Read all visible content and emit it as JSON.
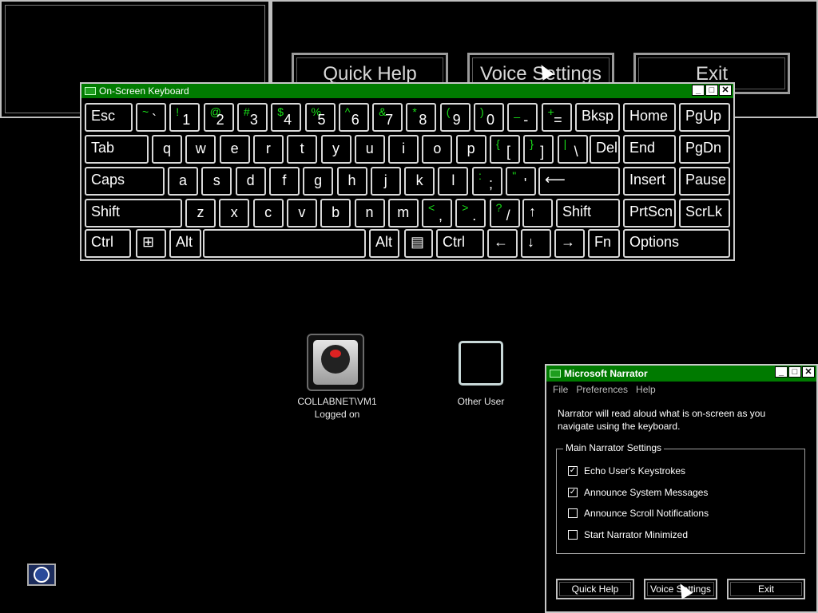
{
  "background": {
    "buttons": [
      {
        "label": "Quick Help"
      },
      {
        "label": "Voice Settings"
      },
      {
        "label": "Exit"
      }
    ]
  },
  "osk": {
    "title": "On-Screen Keyboard",
    "keys": {
      "esc": "Esc",
      "bksp": "Bksp",
      "home": "Home",
      "pgup": "PgUp",
      "tab": "Tab",
      "del": "Del",
      "end": "End",
      "pgdn": "PgDn",
      "caps": "Caps",
      "insert": "Insert",
      "pause": "Pause",
      "shift_l": "Shift",
      "shift_r": "Shift",
      "prtscn": "PrtScn",
      "scrlk": "ScrLk",
      "ctrl_l": "Ctrl",
      "alt_l": "Alt",
      "alt_r": "Alt",
      "ctrl_r": "Ctrl",
      "fn": "Fn",
      "options": "Options",
      "arrow_left": "←",
      "arrow_down": "↓",
      "arrow_right": "→",
      "arrow_up": "↑",
      "windows": "⊞",
      "menu": "▤",
      "row1": [
        {
          "u": "~",
          "l": "`"
        },
        {
          "u": "!",
          "l": "1"
        },
        {
          "u": "@",
          "l": "2"
        },
        {
          "u": "#",
          "l": "3"
        },
        {
          "u": "$",
          "l": "4"
        },
        {
          "u": "%",
          "l": "5"
        },
        {
          "u": "^",
          "l": "6"
        },
        {
          "u": "&",
          "l": "7"
        },
        {
          "u": "*",
          "l": "8"
        },
        {
          "u": "(",
          "l": "9"
        },
        {
          "u": ")",
          "l": "0"
        },
        {
          "u": "_",
          "l": "-"
        },
        {
          "u": "+",
          "l": "="
        }
      ],
      "row2": [
        "q",
        "w",
        "e",
        "r",
        "t",
        "y",
        "u",
        "i",
        "o",
        "p"
      ],
      "row2_sym": [
        {
          "u": "{",
          "l": "["
        },
        {
          "u": "}",
          "l": "]"
        },
        {
          "u": "|",
          "l": "\\"
        }
      ],
      "row3": [
        "a",
        "s",
        "d",
        "f",
        "g",
        "h",
        "j",
        "k",
        "l"
      ],
      "row3_sym": [
        {
          "u": ":",
          "l": ";"
        },
        {
          "u": "\"",
          "l": "'"
        }
      ],
      "row3_enter": "⟵",
      "row4": [
        "z",
        "x",
        "c",
        "v",
        "b",
        "n",
        "m"
      ],
      "row4_sym": [
        {
          "u": "<",
          "l": ","
        },
        {
          "u": ">",
          "l": "."
        },
        {
          "u": "?",
          "l": "/"
        }
      ]
    }
  },
  "users": [
    {
      "name": "COLLABNET\\VM1",
      "status": "Logged on"
    },
    {
      "name": "Other User"
    }
  ],
  "narrator": {
    "title": "Microsoft Narrator",
    "menu": [
      "File",
      "Preferences",
      "Help"
    ],
    "description": "Narrator will read aloud what is on-screen as you navigate using the keyboard.",
    "group_title": "Main Narrator Settings",
    "options": [
      {
        "label": "Echo User's Keystrokes",
        "checked": true
      },
      {
        "label": "Announce System Messages",
        "checked": true
      },
      {
        "label": "Announce Scroll Notifications",
        "checked": false
      },
      {
        "label": "Start Narrator Minimized",
        "checked": false
      }
    ],
    "buttons": [
      {
        "label": "Quick Help"
      },
      {
        "label": "Voice Settings"
      },
      {
        "label": "Exit"
      }
    ]
  },
  "icons": {
    "ease_of_access": "ease-of-access-icon",
    "user_tile": "turntable-icon"
  }
}
